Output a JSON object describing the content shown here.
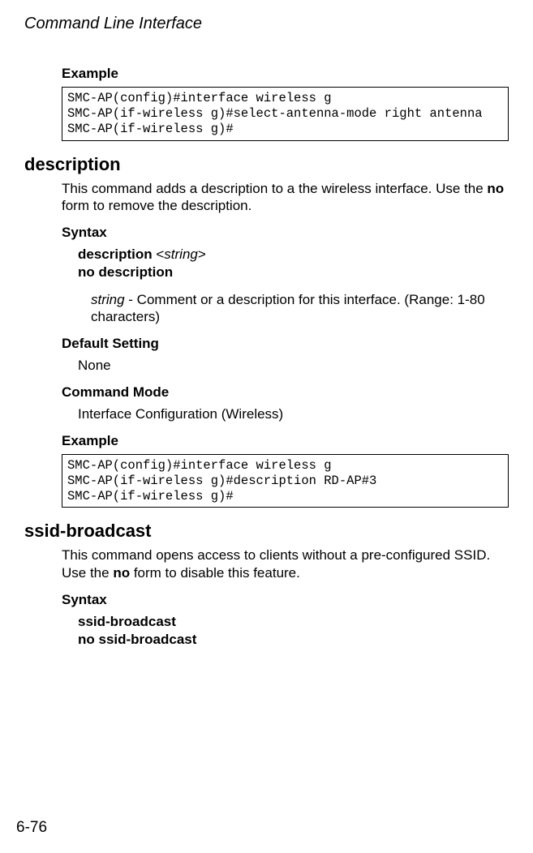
{
  "running_head": "Command Line Interface",
  "page_number": "6-76",
  "example1": {
    "label": "Example",
    "code": "SMC-AP(config)#interface wireless g\nSMC-AP(if-wireless g)#select-antenna-mode right antenna\nSMC-AP(if-wireless g)#"
  },
  "description_cmd": {
    "title": "description",
    "intro_pre": "This command adds a description to a the wireless interface. Use the ",
    "intro_bold": "no",
    "intro_post": " form to remove the description.",
    "syntax_label": "Syntax",
    "syntax_cmd1_kw": "description",
    "syntax_cmd1_arg": "string",
    "syntax_cmd2": "no description",
    "arg_name": "string",
    "arg_desc": " - Comment or a description for this interface. (Range: 1-80 characters)",
    "default_label": "Default Setting",
    "default_value": "None",
    "mode_label": "Command Mode",
    "mode_value": "Interface Configuration (Wireless)",
    "example_label": "Example",
    "example_code": "SMC-AP(config)#interface wireless g\nSMC-AP(if-wireless g)#description RD-AP#3\nSMC-AP(if-wireless g)#"
  },
  "ssid_cmd": {
    "title": "ssid-broadcast",
    "intro_pre": "This command opens access to clients without a pre-configured SSID. Use the ",
    "intro_bold": "no",
    "intro_post": " form to disable this feature.",
    "syntax_label": "Syntax",
    "syntax_cmd1": "ssid-broadcast",
    "syntax_cmd2": "no ssid-broadcast"
  }
}
